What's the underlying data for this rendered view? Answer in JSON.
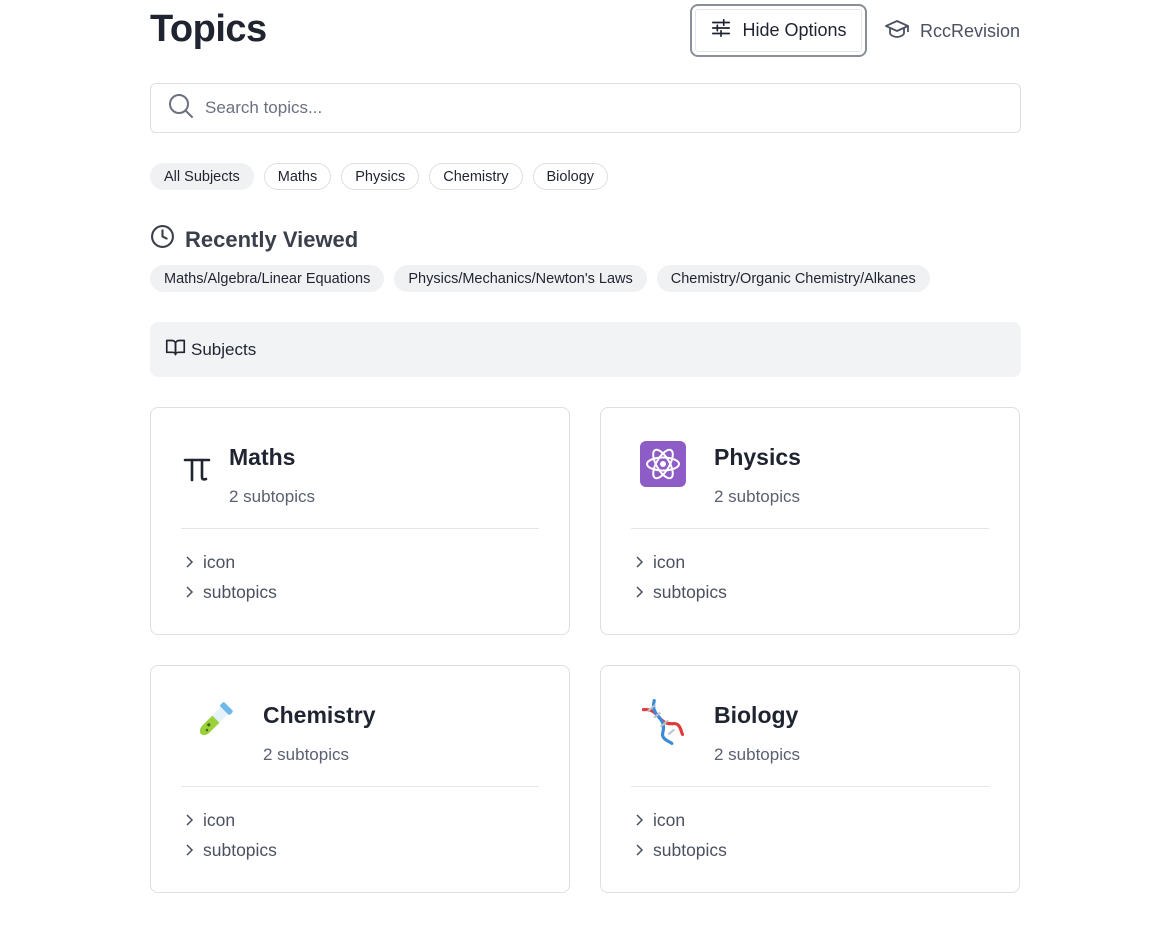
{
  "header": {
    "title": "Topics",
    "hide_options_label": "Hide Options",
    "brand_name": "RccRevision"
  },
  "search": {
    "placeholder": "Search topics...",
    "value": ""
  },
  "filters": [
    "All Subjects",
    "Maths",
    "Physics",
    "Chemistry",
    "Biology"
  ],
  "recent": {
    "title": "Recently Viewed",
    "items": [
      "Maths/Algebra/Linear Equations",
      "Physics/Mechanics/Newton's Laws",
      "Chemistry/Organic Chemistry/Alkanes"
    ]
  },
  "subjects_bar_label": "Subjects",
  "cards": [
    {
      "title": "Maths",
      "subtitle": "2 subtopics",
      "icon": "pi-icon",
      "links": [
        "icon",
        "subtopics"
      ]
    },
    {
      "title": "Physics",
      "subtitle": "2 subtopics",
      "icon": "atom-icon",
      "links": [
        "icon",
        "subtopics"
      ]
    },
    {
      "title": "Chemistry",
      "subtitle": "2 subtopics",
      "icon": "test-tube-icon",
      "links": [
        "icon",
        "subtopics"
      ]
    },
    {
      "title": "Biology",
      "subtitle": "2 subtopics",
      "icon": "dna-icon",
      "links": [
        "icon",
        "subtopics"
      ]
    }
  ],
  "colors": {
    "text": "#1f2430",
    "muted": "#5a6070",
    "border": "#dcdfe3",
    "chip_bg": "#f0f1f3",
    "atom_bg": "#8e5cc7",
    "tube_green": "#9ad13b",
    "tube_blue": "#6fb9e8",
    "dna_red": "#e03b3b",
    "dna_blue": "#3a8ad8"
  }
}
